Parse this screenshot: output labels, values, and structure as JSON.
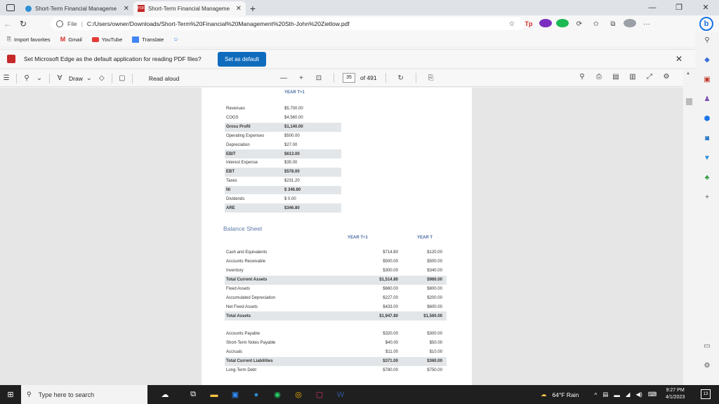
{
  "tabs": [
    {
      "title": "Short-Term Financial Manageme",
      "active": false
    },
    {
      "title": "Short-Term Financial Manageme",
      "active": true
    }
  ],
  "address": {
    "scheme_label": "File",
    "url": "C:/Users/owner/Downloads/Short-Term%20Financial%20Management%20Sth-John%20Zietlow.pdf"
  },
  "favorites": [
    {
      "label": "Import favorites"
    },
    {
      "label": "Gmail"
    },
    {
      "label": "YouTube"
    },
    {
      "label": "Translate"
    }
  ],
  "notification": {
    "message": "Set Microsoft Edge as the default application for reading PDF files?",
    "button_label": "Set as default"
  },
  "pdf_toolbar": {
    "draw_label": "Draw",
    "read_aloud_label": "Read aloud",
    "page_number": "35",
    "page_total": "of 491"
  },
  "income_statement": {
    "year_header": "YEAR T+1",
    "rows": [
      {
        "label": "Revenues",
        "value": "$5,700.00",
        "bold": false
      },
      {
        "label": "COGS",
        "value": "$4,560.00",
        "bold": false
      },
      {
        "label": "Gross Profit",
        "value": "$1,140.00",
        "bold": true
      },
      {
        "label": "Operating Expenses",
        "value": "$500.00",
        "bold": false
      },
      {
        "label": "Depreciation",
        "value": "$27.00",
        "bold": false
      },
      {
        "label": "EBIT",
        "value": "$613.00",
        "bold": true
      },
      {
        "label": "Interest Expense",
        "value": "$35.00",
        "bold": false
      },
      {
        "label": "EBT",
        "value": "$578.00",
        "bold": true
      },
      {
        "label": "Taxes",
        "value": "$231.20",
        "bold": false
      },
      {
        "label": "NI",
        "value": "$ 346.80",
        "bold": true
      },
      {
        "label": "Dividends",
        "value": "$ 0.00",
        "bold": false
      },
      {
        "label": "ARE",
        "value": "$346.80",
        "bold": true
      }
    ]
  },
  "balance_sheet": {
    "title": "Balance Sheet",
    "col1_header": "YEAR T+1",
    "col2_header": "YEAR T",
    "assets": [
      {
        "label": "Cash and Equivalents",
        "v1": "$714.80",
        "v2": "$120.00",
        "bold": false
      },
      {
        "label": "Accounts Receivable",
        "v1": "$500.00",
        "v2": "$500.00",
        "bold": false
      },
      {
        "label": "Inventory",
        "v1": "$300.00",
        "v2": "$340.00",
        "bold": false
      },
      {
        "label": "Total Current Assets",
        "v1": "$1,514.80",
        "v2": "$960.00",
        "bold": true
      },
      {
        "label": "Fixed Assets",
        "v1": "$660.00",
        "v2": "$800.00",
        "bold": false
      },
      {
        "label": "Accumulated Depreciation",
        "v1": "$227.00",
        "v2": "$200.00",
        "bold": false
      },
      {
        "label": "Net Fixed Assets",
        "v1": "$433.00",
        "v2": "$600.00",
        "bold": false
      },
      {
        "label": "Total Assets",
        "v1": "$1,947.80",
        "v2": "$1,560.00",
        "bold": true
      }
    ],
    "liabilities": [
      {
        "label": "Accounts Payable",
        "v1": "$320.00",
        "v2": "$300.00",
        "bold": false
      },
      {
        "label": "Short-Term Notes Payable",
        "v1": "$40.00",
        "v2": "$50.00",
        "bold": false
      },
      {
        "label": "Accruals",
        "v1": "$11.00",
        "v2": "$10.00",
        "bold": false
      },
      {
        "label": "Total Current Liabilities",
        "v1": "$371.00",
        "v2": "$360.00",
        "bold": true
      },
      {
        "label": "Long-Term Debt",
        "v1": "$780.00",
        "v2": "$750.00",
        "bold": false
      }
    ]
  },
  "taskbar": {
    "search_placeholder": "Type here to search",
    "weather": "64°F Rain",
    "time": "9:27 PM",
    "date": "4/1/2023",
    "notification_count": "13"
  }
}
